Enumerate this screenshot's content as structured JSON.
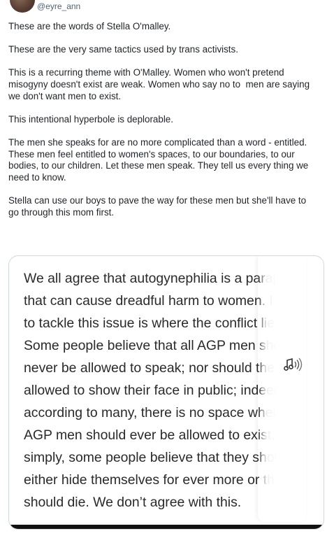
{
  "author": {
    "handle": "@eyre_ann"
  },
  "tweet": {
    "paragraphs": [
      "These are the words of Stella O'malley.",
      "These are the very same tactics used by trans activists.",
      "This is a recurring theme with O'Malley. Women who won't pretend\nmisogyny doesn't exist are weak. Women who say no to  men are saying\nwe don't want men to exist.",
      "This intentional hyperbole is deplorable.",
      "The men she speaks for are no more complicated than a word - entitled.\nThese men feel entitled to women's spaces, to our boundaries, to our\nbodies, to our children. Let these men speak. They tell us every thing we\nneed to know.",
      "Stella can use our boys to pave the way for these men but she'll have to\ngo through this mom first."
    ]
  },
  "quote_image": {
    "lines": [
      "We all agree that autogynephilia is a parap",
      "that can cause dreadful harm to women. I",
      "to tackle this issue is where the conflict lie",
      "Some people believe that all AGP men sho",
      "never be allowed to speak; nor should they",
      "allowed to show their face in public; indeed,",
      "according to many, there is no space where",
      "AGP men should ever be allowed to exist. Put",
      "simply, some people believe that they should",
      "either hide themselves for ever more or they",
      "should die. We don’t agree with this."
    ]
  },
  "icons": {
    "avatar": "user-avatar",
    "audio": "audio-speaker-icon"
  }
}
